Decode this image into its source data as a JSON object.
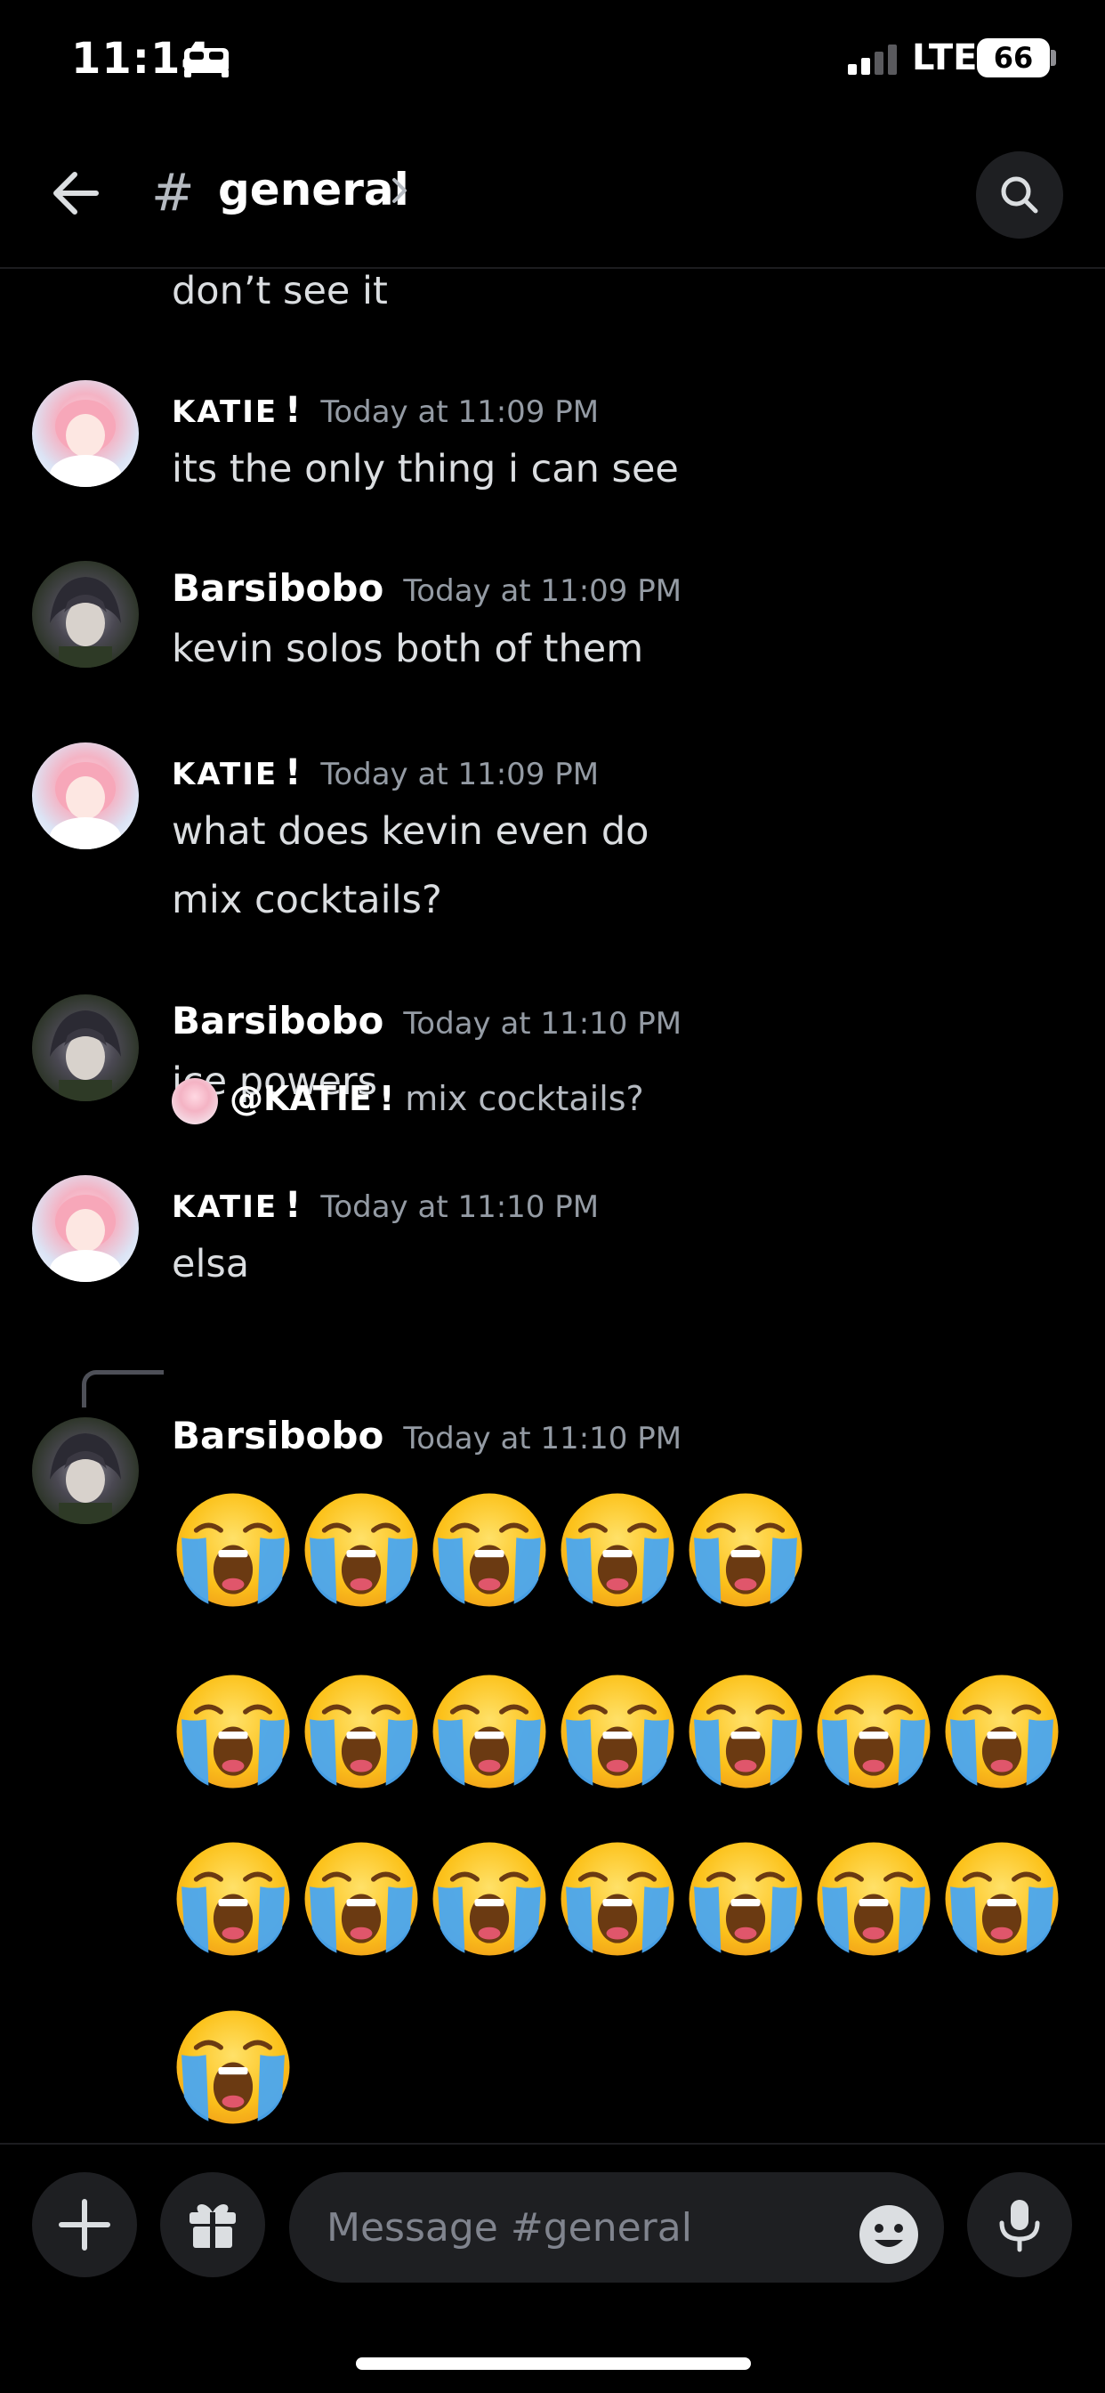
{
  "status_bar": {
    "time": "11:14",
    "network": "LTE",
    "battery": "66",
    "sleep_icon": "bed-icon",
    "signal_icon": "signal-bars-icon"
  },
  "header": {
    "hash": "#",
    "channel_name": "general",
    "back_icon": "arrow-left-icon",
    "chevron_icon": "chevron-right-icon",
    "search_icon": "search-icon"
  },
  "messages": {
    "partial_text": "don’t see it",
    "m1": {
      "author": "KATIE",
      "badge": "!",
      "timestamp": "Today at 11:09 PM",
      "lines": [
        "its the only thing i can see"
      ]
    },
    "m2": {
      "author": "Barsibobo",
      "timestamp": "Today at 11:09 PM",
      "lines": [
        "kevin solos both of them"
      ]
    },
    "m3": {
      "author": "KATIE",
      "badge": "!",
      "timestamp": "Today at 11:09 PM",
      "lines": [
        "what does kevin even do",
        "mix cocktails?"
      ]
    },
    "m4": {
      "author": "Barsibobo",
      "timestamp": "Today at 11:10 PM",
      "lines": [
        "ice powers"
      ]
    },
    "m5": {
      "author": "KATIE",
      "badge": "!",
      "timestamp": "Today at 11:10 PM",
      "lines": [
        "elsa"
      ]
    },
    "m6": {
      "reply_mention": "@KATIE",
      "reply_badge": "!",
      "reply_snippet": "mix cocktails?",
      "author": "Barsibobo",
      "timestamp": "Today at 11:10 PM",
      "emoji_name": "loudly-crying-face-emoji",
      "emoji_count": 20
    }
  },
  "composer": {
    "placeholder": "Message #general",
    "plus_icon": "plus-icon",
    "gift_icon": "gift-icon",
    "emoji_icon": "smiley-icon",
    "mic_icon": "microphone-icon"
  },
  "colors": {
    "background": "#000000",
    "surface": "#1e1f22",
    "text_primary": "#ffffff",
    "text_message": "#dbdee1",
    "text_muted": "#949ba4"
  }
}
